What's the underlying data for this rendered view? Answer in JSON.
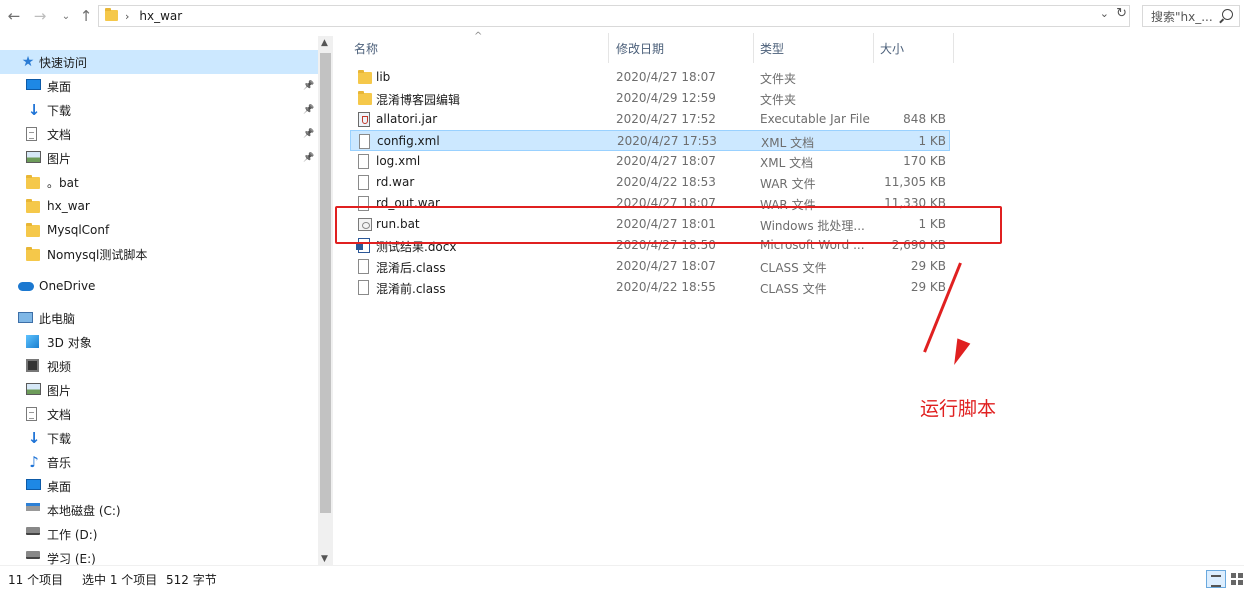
{
  "toolbar": {
    "back_icon": "back-arrow-icon",
    "forward_icon": "forward-arrow-icon",
    "recent_icon": "chevron-down-icon",
    "up_icon": "up-arrow-icon"
  },
  "address": {
    "path": "hx_war",
    "separator": "›"
  },
  "search": {
    "placeholder": "搜索\"hx_..."
  },
  "sidebar": {
    "quick_access": "快速访问",
    "quick_items": [
      {
        "label": "桌面",
        "icon": "desktop-icon",
        "pinned": true
      },
      {
        "label": "下载",
        "icon": "download-icon",
        "pinned": true
      },
      {
        "label": "文档",
        "icon": "document-icon",
        "pinned": true
      },
      {
        "label": "图片",
        "icon": "picture-icon",
        "pinned": true
      },
      {
        "label": "。bat",
        "icon": "folder-icon",
        "pinned": false
      },
      {
        "label": "hx_war",
        "icon": "folder-icon",
        "pinned": false
      },
      {
        "label": "MysqlConf",
        "icon": "folder-icon",
        "pinned": false
      },
      {
        "label": "Nomysql测试脚本",
        "icon": "folder-icon",
        "pinned": false
      }
    ],
    "onedrive": "OneDrive",
    "this_pc": "此电脑",
    "pc_items": [
      {
        "label": "3D 对象",
        "icon": "3d-objects-icon"
      },
      {
        "label": "视频",
        "icon": "video-icon"
      },
      {
        "label": "图片",
        "icon": "picture-icon"
      },
      {
        "label": "文档",
        "icon": "document-icon"
      },
      {
        "label": "下载",
        "icon": "download-icon"
      },
      {
        "label": "音乐",
        "icon": "music-icon"
      },
      {
        "label": "桌面",
        "icon": "desktop-icon"
      },
      {
        "label": "本地磁盘 (C:)",
        "icon": "drive-c-icon"
      },
      {
        "label": "工作 (D:)",
        "icon": "drive-icon"
      },
      {
        "label": "学习 (E:)",
        "icon": "drive-icon"
      }
    ]
  },
  "columns": {
    "name": "名称",
    "date": "修改日期",
    "type": "类型",
    "size": "大小"
  },
  "files": [
    {
      "name": "lib",
      "date": "2020/4/27 18:07",
      "type": "文件夹",
      "size": "",
      "icon": "folder-icon"
    },
    {
      "name": "混淆博客园编辑",
      "date": "2020/4/29 12:59",
      "type": "文件夹",
      "size": "",
      "icon": "folder-icon"
    },
    {
      "name": "allatori.jar",
      "date": "2020/4/27 17:52",
      "type": "Executable Jar File",
      "size": "848 KB",
      "icon": "jar-file-icon"
    },
    {
      "name": "config.xml",
      "date": "2020/4/27 17:53",
      "type": "XML 文档",
      "size": "1 KB",
      "icon": "file-icon"
    },
    {
      "name": "log.xml",
      "date": "2020/4/27 18:07",
      "type": "XML 文档",
      "size": "170 KB",
      "icon": "file-icon"
    },
    {
      "name": "rd.war",
      "date": "2020/4/22 18:53",
      "type": "WAR 文件",
      "size": "11,305 KB",
      "icon": "file-icon"
    },
    {
      "name": "rd_out.war",
      "date": "2020/4/27 18:07",
      "type": "WAR 文件",
      "size": "11,330 KB",
      "icon": "file-icon"
    },
    {
      "name": "run.bat",
      "date": "2020/4/27 18:01",
      "type": "Windows 批处理...",
      "size": "1 KB",
      "icon": "batch-file-icon"
    },
    {
      "name": "测试结果.docx",
      "date": "2020/4/27 18:50",
      "type": "Microsoft Word ...",
      "size": "2,690 KB",
      "icon": "word-document-icon"
    },
    {
      "name": "混淆后.class",
      "date": "2020/4/27 18:07",
      "type": "CLASS 文件",
      "size": "29 KB",
      "icon": "file-icon"
    },
    {
      "name": "混淆前.class",
      "date": "2020/4/22 18:55",
      "type": "CLASS 文件",
      "size": "29 KB",
      "icon": "file-icon"
    }
  ],
  "selected_index": 3,
  "annotation": {
    "text": "运行脚本",
    "color": "#e02020"
  },
  "status": {
    "count": "11 个项目",
    "selection": "选中 1 个项目",
    "size": "512 字节"
  },
  "colors": {
    "selection": "#cce8ff",
    "folder": "#f5c84a",
    "annotation": "#e02020"
  }
}
